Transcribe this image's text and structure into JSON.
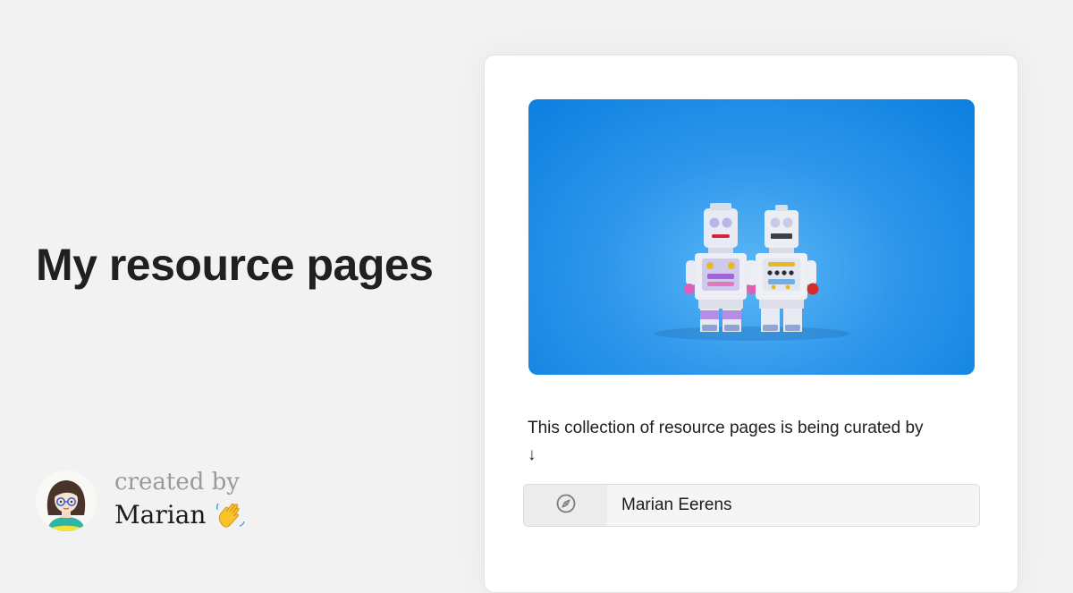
{
  "page": {
    "title": "My resource pages"
  },
  "creator": {
    "created_by_label": "created by",
    "name": "Marian",
    "emoji": "wave-icon"
  },
  "card": {
    "cover_image": "two-robot-toys-on-blue-background",
    "description": "This collection of resource pages is being curated by",
    "arrow": "↓",
    "link": {
      "icon": "compass-icon",
      "label": "Marian Eerens"
    }
  },
  "colors": {
    "background": "#f1f2f1",
    "card": "#ffffff",
    "cover_blue": "#2f97ec",
    "muted_text": "#9a9a9a"
  }
}
